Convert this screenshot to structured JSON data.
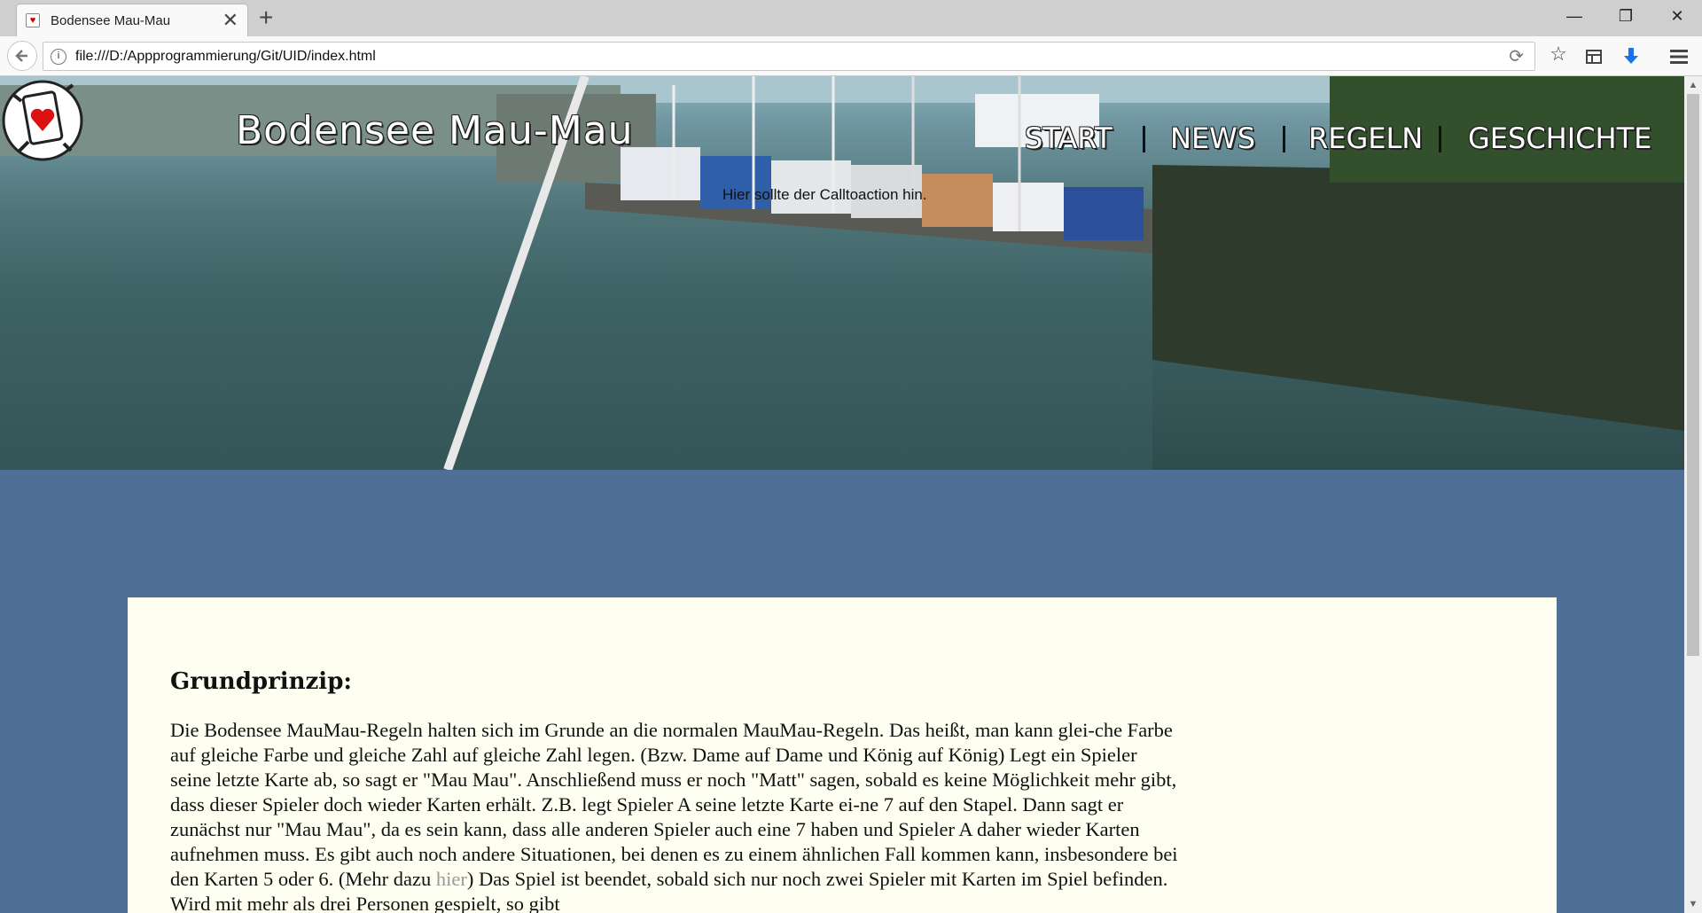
{
  "browser": {
    "tab_title": "Bodensee Mau-Mau",
    "tab_close": "✕",
    "new_tab": "+",
    "url": "file:///D:/Appprogrammierung/Git/UID/index.html",
    "window_controls": {
      "minimize": "—",
      "restore": "❐",
      "close": "✕"
    }
  },
  "header": {
    "site_title": "Bodensee Mau-Mau",
    "nav": [
      {
        "label": "START"
      },
      {
        "label": "NEWS"
      },
      {
        "label": "REGELN"
      },
      {
        "label": "GESCHICHTE"
      }
    ],
    "cta_text": "Hier sollte der Calltoaction hin."
  },
  "content": {
    "heading": "Grundprinzip:",
    "paragraph_before_link": "Die Bodensee MauMau-Regeln halten sich im Grunde an die normalen MauMau-Regeln. Das heißt, man kann glei-che Farbe auf gleiche Farbe und gleiche Zahl auf gleiche Zahl legen. (Bzw. Dame auf Dame und König auf König) Legt ein Spieler seine letzte Karte ab, so sagt er \"Mau Mau\". Anschließend muss er noch \"Matt\" sagen, sobald es keine Möglichkeit mehr gibt, dass dieser Spieler doch wieder Karten erhält. Z.B. legt Spieler A seine letzte Karte ei-ne 7 auf den Stapel. Dann sagt er zunächst nur \"Mau Mau\", da es sein kann, dass alle anderen Spieler auch eine 7 haben und Spieler A daher wieder Karten aufnehmen muss. Es gibt auch noch andere Situationen, bei denen es zu einem ähnlichen Fall kommen kann, insbesondere bei den Karten 5 oder 6. (Mehr dazu ",
    "link_text": "hier",
    "paragraph_after_link": ") Das Spiel ist beendet, sobald sich nur noch zwei Spieler mit Karten im Spiel befinden. Wird mit mehr als drei Personen gespielt, so gibt"
  },
  "icons": {
    "back": "back-arrow-icon",
    "info": "info-icon",
    "reload": "reload-icon",
    "bookmark": "star-icon",
    "reader": "reader-icon",
    "download": "download-icon",
    "menu": "hamburger-menu-icon"
  },
  "colors": {
    "page_background": "#4e7096",
    "card_background": "#fefff0",
    "link": "#9a9a9a",
    "download_icon": "#1a73e8"
  }
}
